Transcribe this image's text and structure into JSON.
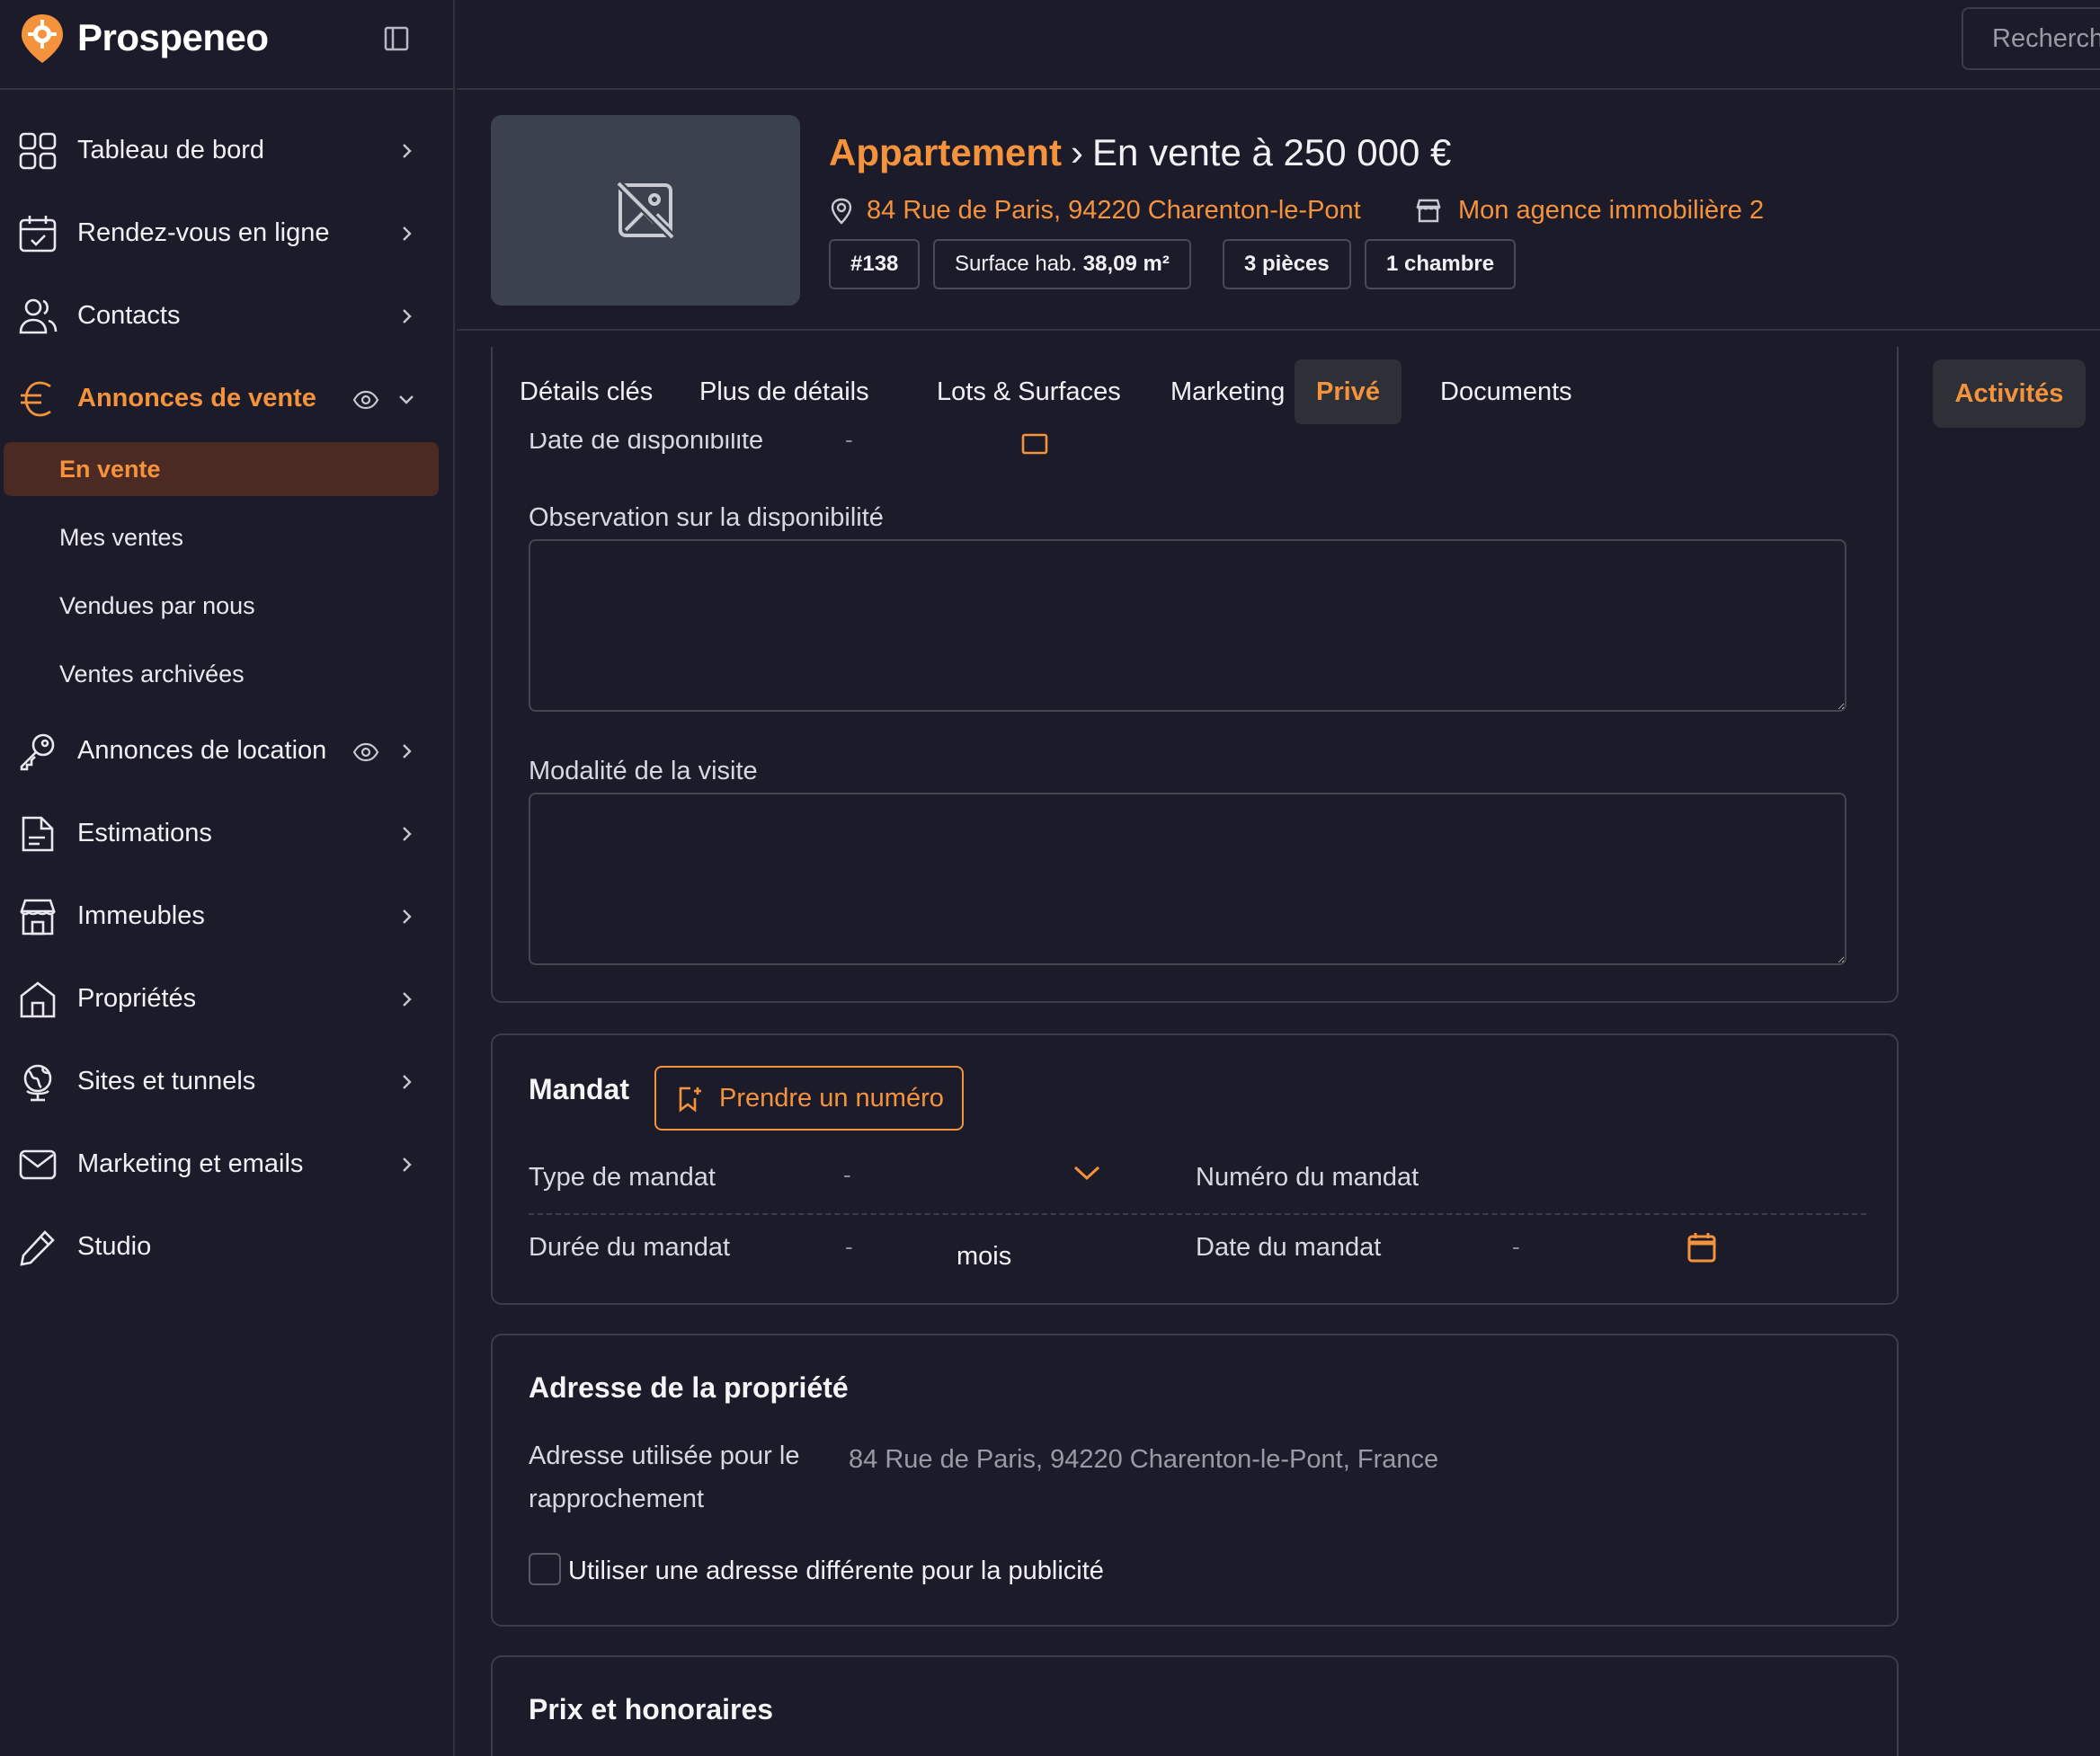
{
  "app": {
    "name": "Prospeneo",
    "search_placeholder": "Recherch",
    "accent": "#f5933d"
  },
  "sidebar": {
    "items": [
      {
        "label": "Tableau de bord",
        "icon": "grid-icon"
      },
      {
        "label": "Rendez-vous en ligne",
        "icon": "calendar-check-icon"
      },
      {
        "label": "Contacts",
        "icon": "users-icon"
      },
      {
        "label": "Annonces de vente",
        "icon": "euro-icon",
        "active": true,
        "expanded": true
      },
      {
        "label": "Annonces de location",
        "icon": "key-icon"
      },
      {
        "label": "Estimations",
        "icon": "document-icon"
      },
      {
        "label": "Immeubles",
        "icon": "storefront-icon"
      },
      {
        "label": "Propriétés",
        "icon": "house-icon"
      },
      {
        "label": "Sites et tunnels",
        "icon": "globe-icon"
      },
      {
        "label": "Marketing et emails",
        "icon": "mail-icon"
      },
      {
        "label": "Studio",
        "icon": "pencil-icon"
      }
    ],
    "sub_items": [
      {
        "label": "En vente",
        "active": true
      },
      {
        "label": "Mes ventes"
      },
      {
        "label": "Vendues par nous"
      },
      {
        "label": "Ventes archivées"
      }
    ]
  },
  "property": {
    "type": "Appartement",
    "separator": "›",
    "status": "En vente à 250 000 €",
    "address": "84 Rue de Paris, 94220 Charenton-le-Pont",
    "agency": "Mon agence immobilière 2",
    "chips": {
      "id": "#138",
      "surface_label": "Surface hab.",
      "surface_value": "38,09 m²",
      "rooms": "3 pièces",
      "bedrooms": "1 chambre"
    }
  },
  "tabs": [
    {
      "label": "Détails clés"
    },
    {
      "label": "Plus de détails"
    },
    {
      "label": "Lots & Surfaces"
    },
    {
      "label": "Marketing"
    },
    {
      "label": "Privé",
      "active": true
    },
    {
      "label": "Documents"
    }
  ],
  "activities_label": "Activités",
  "availability": {
    "date_label": "Date de disponibilité",
    "date_value": "-",
    "observation_label": "Observation sur la disponibilité",
    "visit_label": "Modalité de la visite"
  },
  "mandate": {
    "title": "Mandat",
    "take_number_label": "Prendre un numéro",
    "type_label": "Type de mandat",
    "type_value": "-",
    "number_label": "Numéro du mandat",
    "duration_label": "Durée du mandat",
    "duration_value": "-",
    "duration_unit": "mois",
    "date_label": "Date du mandat",
    "date_value": "-"
  },
  "property_address": {
    "title": "Adresse de la propriété",
    "used_label_line1": "Adresse utilisée pour le",
    "used_label_line2": "rapprochement",
    "used_value": "84 Rue de Paris, 94220 Charenton-le-Pont, France",
    "different_checkbox_label": "Utiliser une adresse différente pour la publicité"
  },
  "pricing": {
    "title": "Prix et honoraires"
  }
}
